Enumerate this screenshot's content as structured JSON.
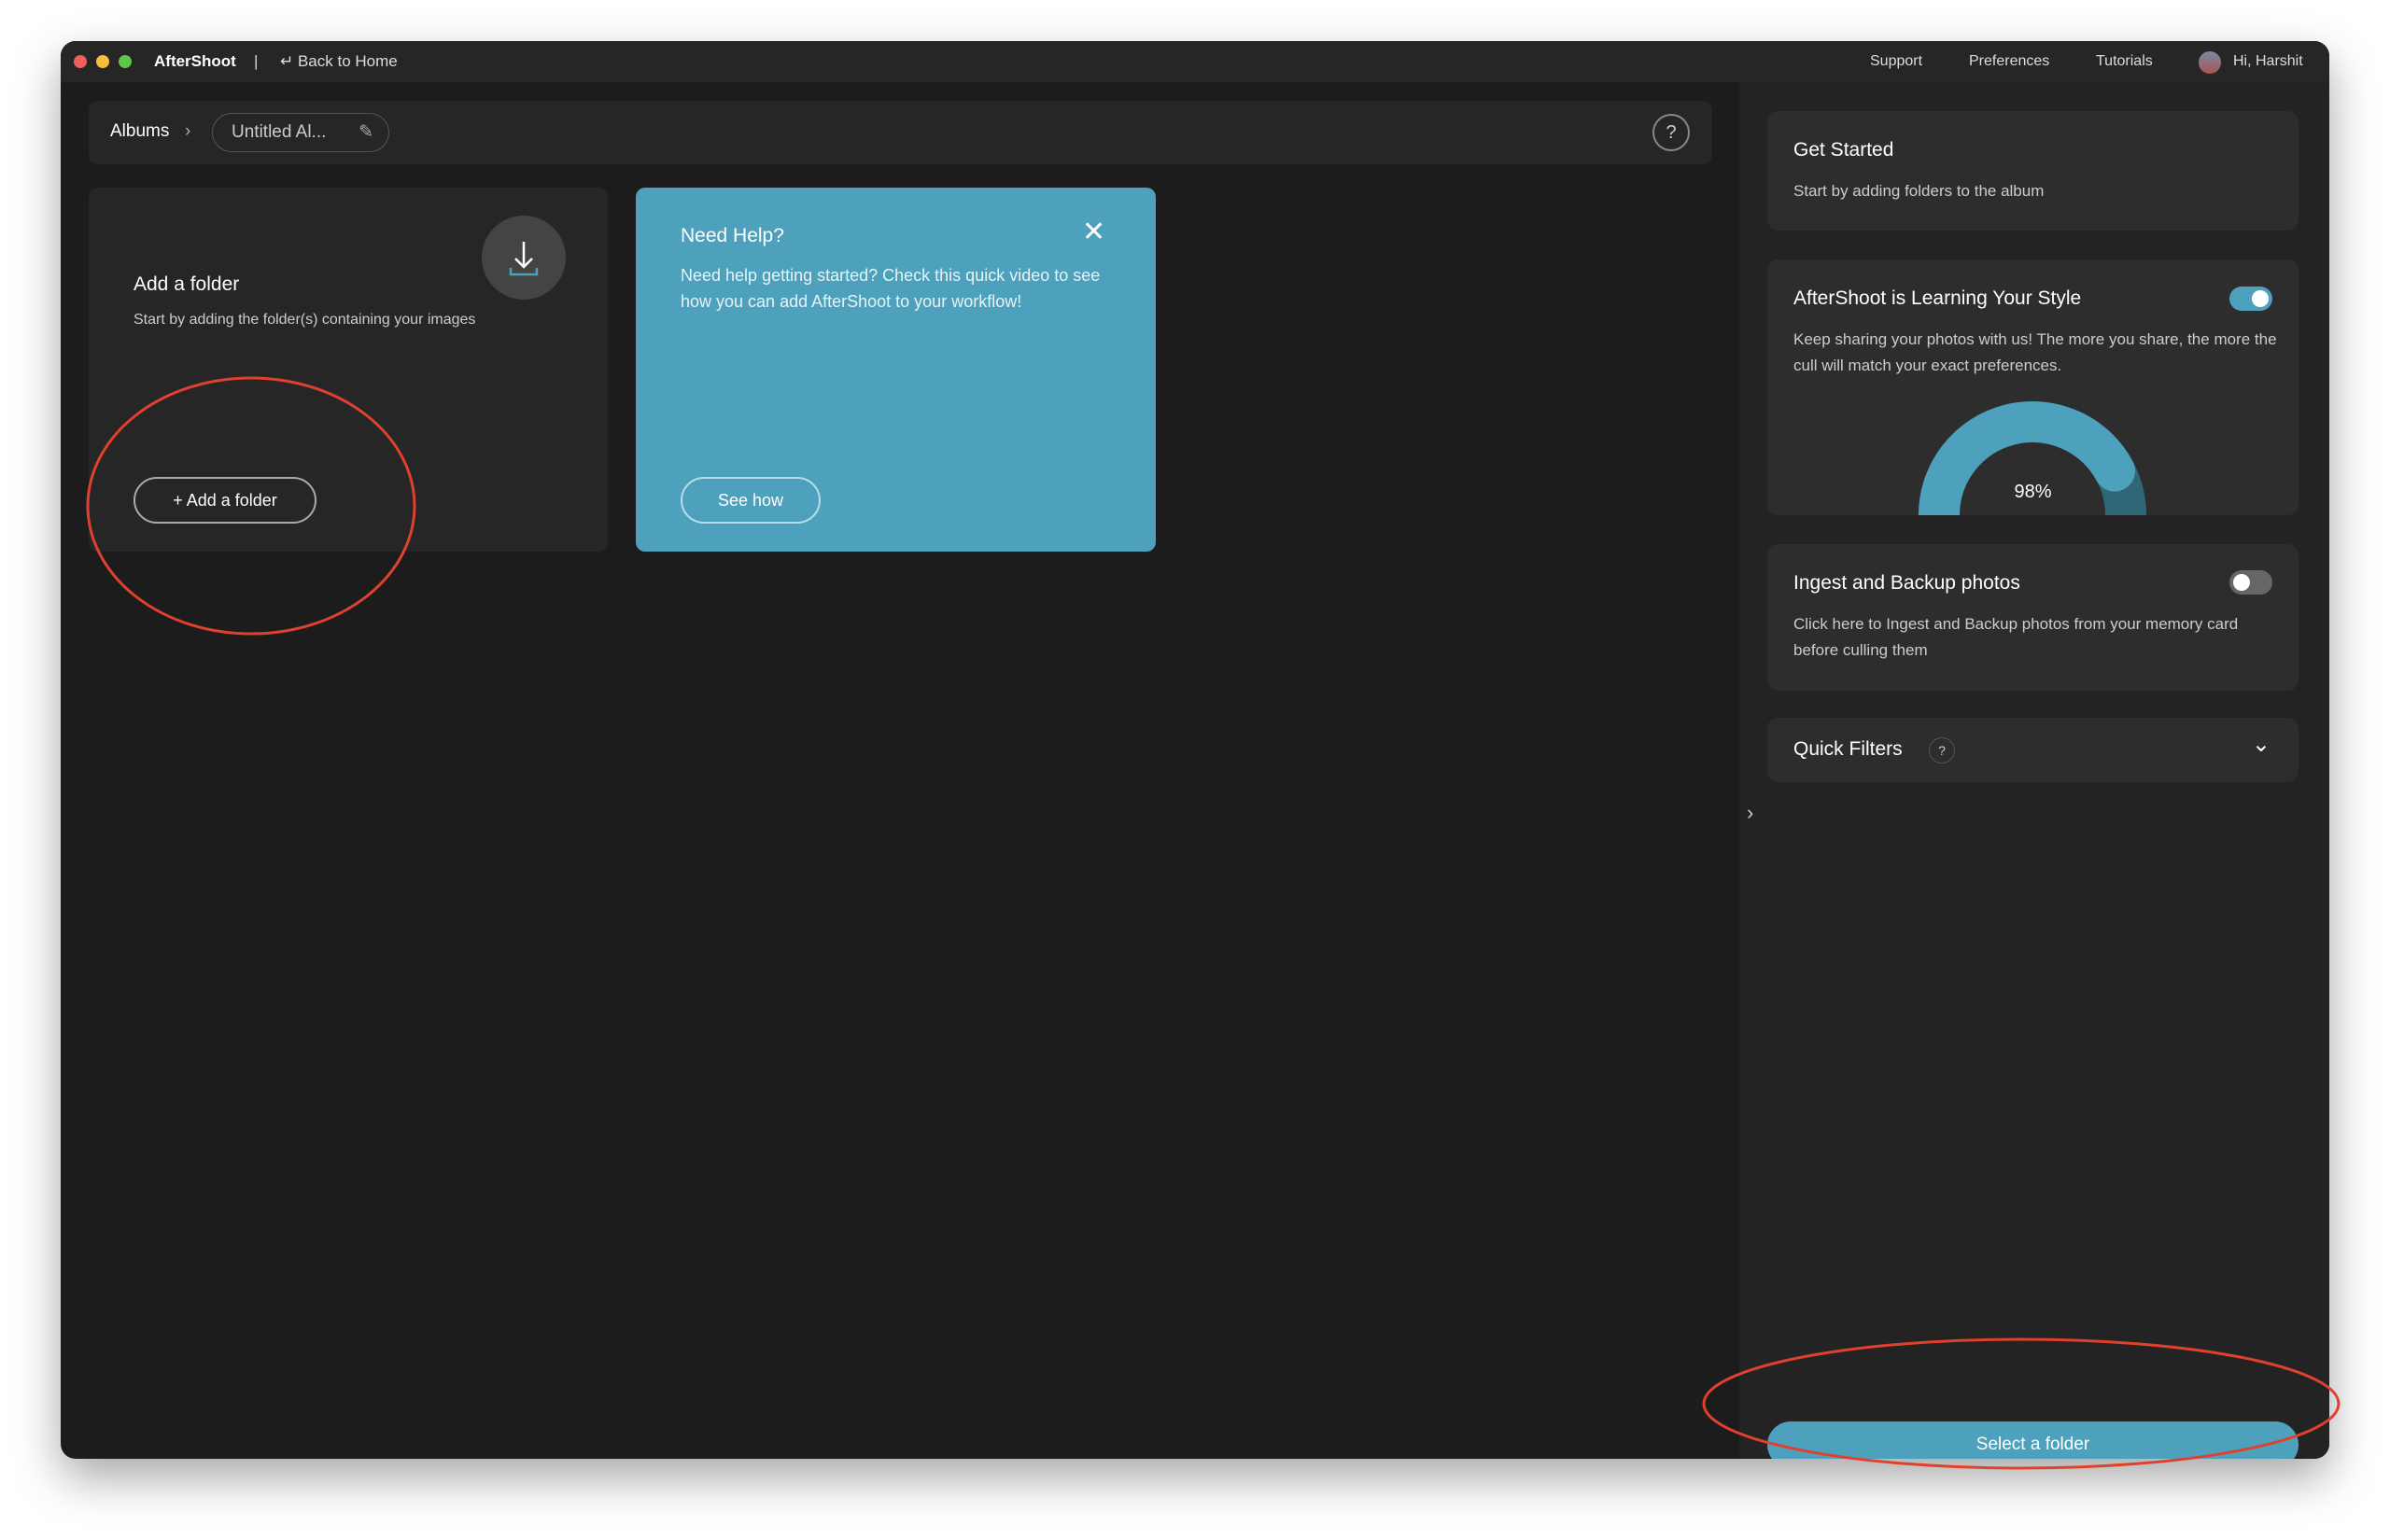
{
  "titlebar": {
    "app_name": "AfterShoot",
    "separator": "|",
    "back_label": "↵ Back to Home",
    "nav": [
      "Support",
      "Preferences",
      "Tutorials"
    ],
    "greeting": "Hi, Harshit"
  },
  "breadcrumb": {
    "root": "Albums",
    "chevron": "›",
    "album": "Untitled Al...",
    "help": "?"
  },
  "add_folder_card": {
    "title": "Add a folder",
    "description": "Start by adding the folder(s) containing your images",
    "button": "+ Add a folder"
  },
  "help_card": {
    "title": "Need Help?",
    "description": "Need help getting started? Check this quick video to see how you can add AfterShoot to your workflow!",
    "button": "See how",
    "close": "✕"
  },
  "sidebar": {
    "get_started": {
      "title": "Get Started",
      "description": "Start by adding folders to the album"
    },
    "learning": {
      "title": "AfterShoot is Learning Your Style",
      "description": "Keep sharing your photos with us! The more you share, the more the cull will match your exact preferences.",
      "toggle_on": true,
      "progress_percent": 98,
      "progress_label": "98%"
    },
    "ingest": {
      "title": "Ingest and Backup photos",
      "description": "Click here to Ingest and Backup photos from your memory card before culling them",
      "toggle_on": false
    },
    "quick_filters": {
      "title": "Quick Filters",
      "help": "?",
      "chevron": "⌄"
    },
    "collapse": "›",
    "select_button": "Select a folder"
  },
  "colors": {
    "accent": "#4ea1bc",
    "annotation": "#e0412e",
    "background": "#1c1c1c"
  }
}
